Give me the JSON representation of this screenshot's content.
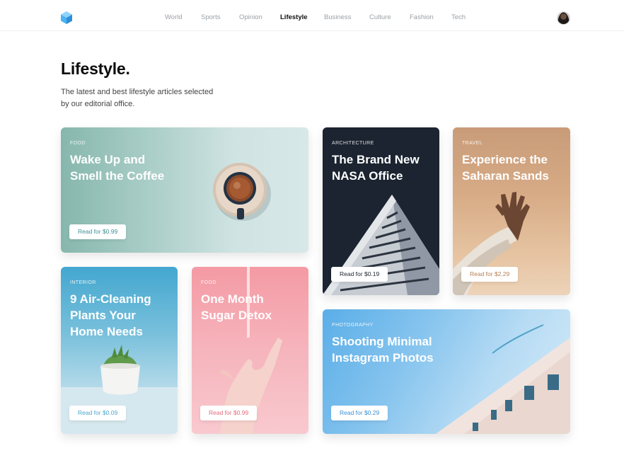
{
  "header": {
    "nav": [
      {
        "label": "World",
        "active": false
      },
      {
        "label": "Sports",
        "active": false
      },
      {
        "label": "Opinion",
        "active": false
      },
      {
        "label": "Lifestyle",
        "active": true
      },
      {
        "label": "Business",
        "active": false
      },
      {
        "label": "Culture",
        "active": false
      },
      {
        "label": "Fashion",
        "active": false
      },
      {
        "label": "Tech",
        "active": false
      }
    ]
  },
  "intro": {
    "title": "Lifestyle.",
    "subtitle_line1": "The latest and best lifestyle articles selected",
    "subtitle_line2": "by our editorial office."
  },
  "cards": [
    {
      "category": "FOOD",
      "title_line1": "Wake Up and",
      "title_line2": "Smell the Coffee",
      "title_line3": "",
      "button": "Read for $0.99"
    },
    {
      "category": "ARCHITECTURE",
      "title_line1": "The Brand New",
      "title_line2": "NASA Office",
      "title_line3": "",
      "button": "Read for $0.19"
    },
    {
      "category": "TRAVEL",
      "title_line1": "Experience the",
      "title_line2": "Saharan Sands",
      "title_line3": "",
      "button": "Read for $2.29"
    },
    {
      "category": "INTERIOR",
      "title_line1": "9 Air-Cleaning",
      "title_line2": "Plants Your",
      "title_line3": "Home Needs",
      "button": "Read for $0.09"
    },
    {
      "category": "FOOD",
      "title_line1": "One Month",
      "title_line2": "Sugar Detox",
      "title_line3": "",
      "button": "Read for $0.99"
    },
    {
      "category": "PHOTOGRAPHY",
      "title_line1": "Shooting Minimal",
      "title_line2": "Instagram Photos",
      "title_line3": "",
      "button": "Read for $0.29"
    }
  ],
  "colors": {
    "accent_button_text": "#3d8f96",
    "nav_inactive": "#9aa0a6",
    "nav_active": "#111111",
    "logo": "#4ab3f0"
  },
  "icons": {
    "logo": "cube-logo-icon",
    "avatar": "user-avatar"
  }
}
